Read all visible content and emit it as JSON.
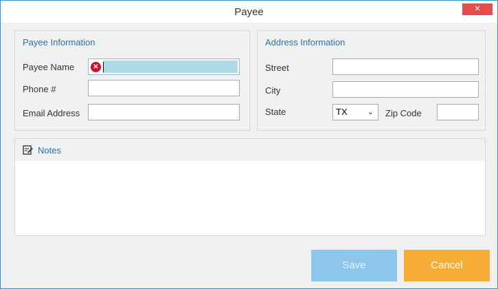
{
  "window": {
    "title": "Payee",
    "close_glyph": "✕"
  },
  "payee_info": {
    "title": "Payee Information",
    "name_label": "Payee Name",
    "phone_label": "Phone #",
    "email_label": "Email Address",
    "name_value": "",
    "phone_value": "",
    "email_value": "",
    "error_glyph": "✕"
  },
  "address_info": {
    "title": "Address Information",
    "street_label": "Street",
    "city_label": "City",
    "state_label": "State",
    "zip_label": "Zip Code",
    "state_value": "TX",
    "street_value": "",
    "city_value": "",
    "zip_value": ""
  },
  "notes": {
    "title": "Notes",
    "icon": "notes-edit-icon",
    "value": ""
  },
  "footer": {
    "save_label": "Save",
    "cancel_label": "Cancel"
  },
  "colors": {
    "accent": "#2f8fd8",
    "close": "#e74c4c",
    "save": "#8cc6ea",
    "cancel": "#f5ad35",
    "error": "#c8102e",
    "selection": "#add8e6"
  }
}
